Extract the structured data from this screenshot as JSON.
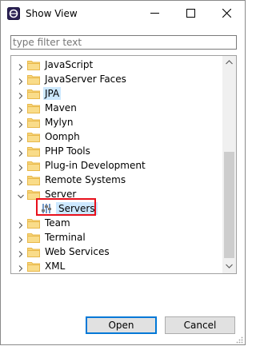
{
  "window": {
    "title": "Show View"
  },
  "filter": {
    "placeholder": "type filter text",
    "value": ""
  },
  "tree": {
    "items": [
      {
        "label": "JavaScript",
        "expanded": false
      },
      {
        "label": "JavaServer Faces",
        "expanded": false
      },
      {
        "label": "JPA",
        "expanded": false,
        "highlighted": true
      },
      {
        "label": "Maven",
        "expanded": false
      },
      {
        "label": "Mylyn",
        "expanded": false
      },
      {
        "label": "Oomph",
        "expanded": false
      },
      {
        "label": "PHP Tools",
        "expanded": false
      },
      {
        "label": "Plug-in Development",
        "expanded": false
      },
      {
        "label": "Remote Systems",
        "expanded": false
      },
      {
        "label": "Server",
        "expanded": true,
        "children": [
          {
            "label": "Servers",
            "selected": true,
            "icon": "servers-view-icon"
          }
        ]
      },
      {
        "label": "Team",
        "expanded": false
      },
      {
        "label": "Terminal",
        "expanded": false
      },
      {
        "label": "Web Services",
        "expanded": false
      },
      {
        "label": "XML",
        "expanded": false
      }
    ]
  },
  "buttons": {
    "open": "Open",
    "cancel": "Cancel"
  },
  "colors": {
    "selection": "#cce8ff",
    "focus_border": "#0078d7",
    "annotation": "#e8101c",
    "folder": "#e8b84a"
  }
}
